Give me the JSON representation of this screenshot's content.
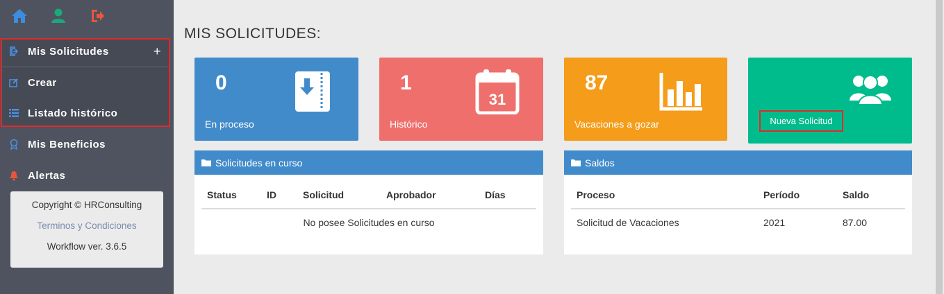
{
  "colors": {
    "sidebar_bg": "#4e535f",
    "highlight_border": "#e02a2a",
    "blue": "#428bca",
    "red": "#ef6f6c",
    "orange": "#f59c1a",
    "green": "#00bc8c"
  },
  "topbar_icons": [
    "home-icon",
    "user-icon",
    "logout-icon"
  ],
  "sidebar": {
    "items": [
      {
        "label": "Mis Solicitudes",
        "icon": "sign-in-icon",
        "expand": "+"
      },
      {
        "label": "Crear",
        "icon": "edit-icon"
      },
      {
        "label": "Listado histórico",
        "icon": "list-icon"
      },
      {
        "label": "Mis Beneficios",
        "icon": "award-icon"
      },
      {
        "label": "Alertas",
        "icon": "bell-icon"
      }
    ],
    "copyright": "Copyright © HRConsulting",
    "terms": "Terminos y Condiciones",
    "version": "Workflow ver. 3.6.5"
  },
  "main": {
    "title": "MIS SOLICITUDES:",
    "tiles": [
      {
        "value": "0",
        "label": "En proceso",
        "icon": "download-binder-icon"
      },
      {
        "value": "1",
        "label": "Histórico",
        "icon": "calendar-icon",
        "icon_text": "31"
      },
      {
        "value": "87",
        "label": "Vacaciones a gozar",
        "icon": "bar-chart-icon"
      },
      {
        "label": "Nueva Solicitud",
        "icon": "users-icon"
      }
    ],
    "panel_curso": {
      "title": "Solicitudes en curso",
      "headers": [
        "Status",
        "ID",
        "Solicitud",
        "Aprobador",
        "Días"
      ],
      "empty": "No posee Solicitudes en curso"
    },
    "panel_saldos": {
      "title": "Saldos",
      "headers": [
        "Proceso",
        "Período",
        "Saldo"
      ],
      "rows": [
        [
          "Solicitud de Vacaciones",
          "2021",
          "87.00"
        ]
      ]
    }
  }
}
